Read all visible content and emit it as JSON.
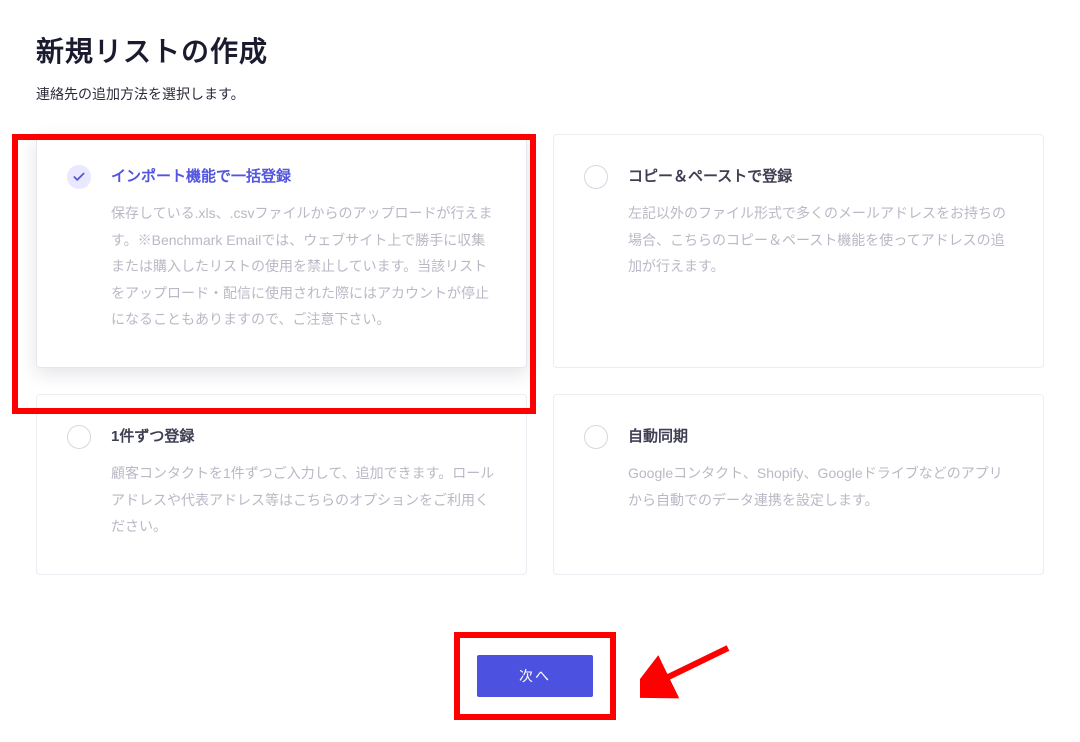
{
  "page": {
    "title": "新規リストの作成",
    "subtitle": "連絡先の追加方法を選択します。"
  },
  "options": [
    {
      "title": "インポート機能で一括登録",
      "description": "保存している.xls、.csvファイルからのアップロードが行えます。※Benchmark Emailでは、ウェブサイト上で勝手に収集または購入したリストの使用を禁止しています。当該リストをアップロード・配信に使用された際にはアカウントが停止になることもありますので、ご注意下さい。",
      "selected": true
    },
    {
      "title": "コピー＆ペーストで登録",
      "description": "左記以外のファイル形式で多くのメールアドレスをお持ちの場合、こちらのコピー＆ペースト機能を使ってアドレスの追加が行えます。",
      "selected": false
    },
    {
      "title": "1件ずつ登録",
      "description": "顧客コンタクトを1件ずつご入力して、追加できます。ロールアドレスや代表アドレス等はこちらのオプションをご利用ください。",
      "selected": false
    },
    {
      "title": "自動同期",
      "description": "Googleコンタクト、Shopify、Googleドライブなどのアプリから自動でのデータ連携を設定します。",
      "selected": false
    }
  ],
  "buttons": {
    "next": "次へ"
  }
}
